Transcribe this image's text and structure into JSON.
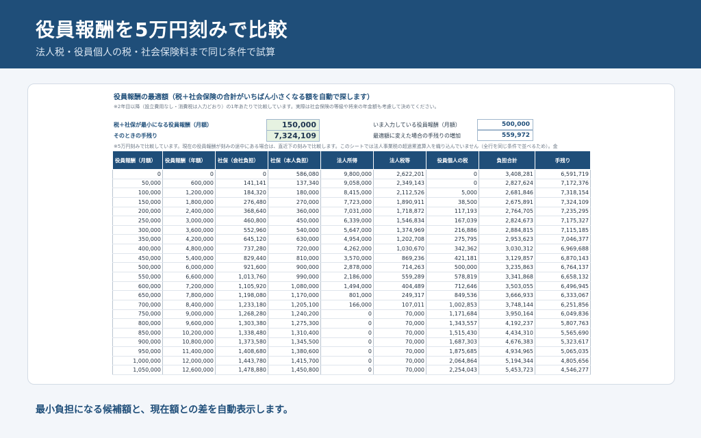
{
  "header": {
    "title": "役員報酬を5万円刻みで比較",
    "subtitle": "法人税・役員個人の税・社会保険料まで同じ条件で試算"
  },
  "sheet": {
    "title": "役員報酬の最適額（税＋社会保険の合計がいちばん小さくなる額を自動で探します）",
    "note": "※2年目以降（設立費用なし・消費税は入力どおり）の1年あたりで比較しています。実際は社会保険の等級や将来の年金額も考慮して決めてください。",
    "optimal_label": "税＋社保が最小になる役員報酬（月額）",
    "optimal_value": "150,000",
    "takehome_label": "そのときの手残り",
    "takehome_value": "7,324,109",
    "current_label": "いま入力している役員報酬（月額）",
    "current_value": "500,000",
    "increase_label": "最適額に変えた場合の手残りの増加",
    "increase_value": "559,972",
    "table_note": "※5万円刻みで比較しています。現在の役員報酬が刻みの途中にある場合は、直近下の刻みで比較します。このシートでは法人事業税の超過累進算入を織り込んでいません（全行を同じ条件で並べるため）。金"
  },
  "table": {
    "headers": [
      "役員報酬（月額）",
      "役員報酬（年額）",
      "社保（会社負担）",
      "社保（本人負担）",
      "法人所得",
      "法人税等",
      "役員個人の税",
      "負担合計",
      "手残り"
    ],
    "rows": [
      [
        "0",
        "0",
        "0",
        "586,080",
        "9,800,000",
        "2,622,201",
        "0",
        "3,408,281",
        "6,591,719"
      ],
      [
        "50,000",
        "600,000",
        "141,141",
        "137,340",
        "9,058,000",
        "2,349,143",
        "0",
        "2,827,624",
        "7,172,376"
      ],
      [
        "100,000",
        "1,200,000",
        "184,320",
        "180,000",
        "8,415,000",
        "2,112,526",
        "5,000",
        "2,681,846",
        "7,318,154"
      ],
      [
        "150,000",
        "1,800,000",
        "276,480",
        "270,000",
        "7,723,000",
        "1,890,911",
        "38,500",
        "2,675,891",
        "7,324,109"
      ],
      [
        "200,000",
        "2,400,000",
        "368,640",
        "360,000",
        "7,031,000",
        "1,718,872",
        "117,193",
        "2,764,705",
        "7,235,295"
      ],
      [
        "250,000",
        "3,000,000",
        "460,800",
        "450,000",
        "6,339,000",
        "1,546,834",
        "167,039",
        "2,824,673",
        "7,175,327"
      ],
      [
        "300,000",
        "3,600,000",
        "552,960",
        "540,000",
        "5,647,000",
        "1,374,969",
        "216,886",
        "2,884,815",
        "7,115,185"
      ],
      [
        "350,000",
        "4,200,000",
        "645,120",
        "630,000",
        "4,954,000",
        "1,202,708",
        "275,795",
        "2,953,623",
        "7,046,377"
      ],
      [
        "400,000",
        "4,800,000",
        "737,280",
        "720,000",
        "4,262,000",
        "1,030,670",
        "342,362",
        "3,030,312",
        "6,969,688"
      ],
      [
        "450,000",
        "5,400,000",
        "829,440",
        "810,000",
        "3,570,000",
        "869,236",
        "421,181",
        "3,129,857",
        "6,870,143"
      ],
      [
        "500,000",
        "6,000,000",
        "921,600",
        "900,000",
        "2,878,000",
        "714,263",
        "500,000",
        "3,235,863",
        "6,764,137"
      ],
      [
        "550,000",
        "6,600,000",
        "1,013,760",
        "990,000",
        "2,186,000",
        "559,289",
        "578,819",
        "3,341,868",
        "6,658,132"
      ],
      [
        "600,000",
        "7,200,000",
        "1,105,920",
        "1,080,000",
        "1,494,000",
        "404,489",
        "712,646",
        "3,503,055",
        "6,496,945"
      ],
      [
        "650,000",
        "7,800,000",
        "1,198,080",
        "1,170,000",
        "801,000",
        "249,317",
        "849,536",
        "3,666,933",
        "6,333,067"
      ],
      [
        "700,000",
        "8,400,000",
        "1,233,180",
        "1,205,100",
        "166,000",
        "107,011",
        "1,002,853",
        "3,748,144",
        "6,251,856"
      ],
      [
        "750,000",
        "9,000,000",
        "1,268,280",
        "1,240,200",
        "0",
        "70,000",
        "1,171,684",
        "3,950,164",
        "6,049,836"
      ],
      [
        "800,000",
        "9,600,000",
        "1,303,380",
        "1,275,300",
        "0",
        "70,000",
        "1,343,557",
        "4,192,237",
        "5,807,763"
      ],
      [
        "850,000",
        "10,200,000",
        "1,338,480",
        "1,310,400",
        "0",
        "70,000",
        "1,515,430",
        "4,434,310",
        "5,565,690"
      ],
      [
        "900,000",
        "10,800,000",
        "1,373,580",
        "1,345,500",
        "0",
        "70,000",
        "1,687,303",
        "4,676,383",
        "5,323,617"
      ],
      [
        "950,000",
        "11,400,000",
        "1,408,680",
        "1,380,600",
        "0",
        "70,000",
        "1,875,685",
        "4,934,965",
        "5,065,035"
      ],
      [
        "1,000,000",
        "12,000,000",
        "1,443,780",
        "1,415,700",
        "0",
        "70,000",
        "2,064,864",
        "5,194,344",
        "4,805,656"
      ],
      [
        "1,050,000",
        "12,600,000",
        "1,478,880",
        "1,450,800",
        "0",
        "70,000",
        "2,254,043",
        "5,453,723",
        "4,546,277"
      ]
    ]
  },
  "caption": "最小負担になる候補額と、現在額との差を自動表示します。",
  "colors": {
    "banner": "#1f4e79",
    "header_row": "#1f4e79",
    "highlight_box": "#e6f2e1"
  }
}
